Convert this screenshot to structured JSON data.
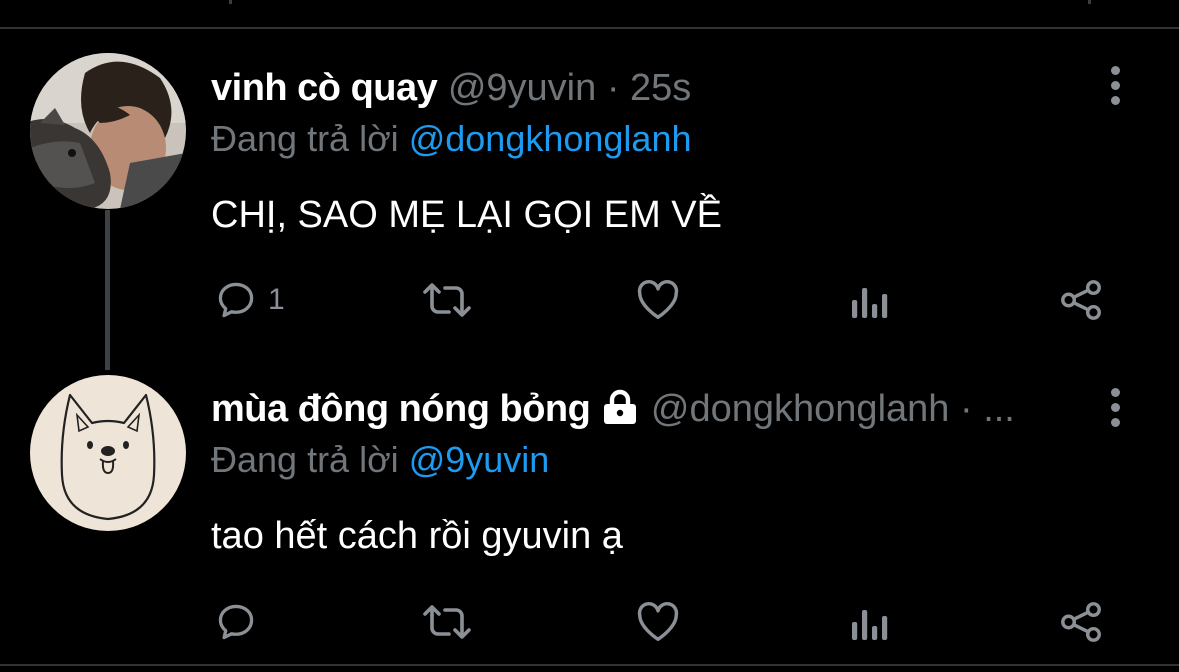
{
  "tweets": [
    {
      "display_name": "vinh cò quay",
      "handle": "@9yuvin",
      "timestamp": "· 25s",
      "reply_prefix": "Đang trả lời",
      "reply_to": "@dongkhonglanh",
      "text": "CHỊ, SAO MẸ LẠI GỌI EM VỀ",
      "reply_count": "1",
      "locked": false
    },
    {
      "display_name": "mùa đông nóng bỏng",
      "handle": "@dongkhonglanh",
      "timestamp": "· ...",
      "reply_prefix": "Đang trả lời",
      "reply_to": "@9yuvin",
      "text": "tao hết cách rồi gyuvin ạ",
      "reply_count": "",
      "locked": true
    }
  ],
  "icons": {
    "reply": "comment-bubble-icon",
    "retweet": "retweet-icon",
    "like": "heart-icon",
    "views": "analytics-bars-icon",
    "share": "share-icon",
    "more": "more-vertical-icon",
    "lock": "lock-icon"
  },
  "colors": {
    "background": "#000000",
    "link": "#1d9bf0",
    "secondary_text": "#71767b",
    "icon": "#8b9096"
  }
}
